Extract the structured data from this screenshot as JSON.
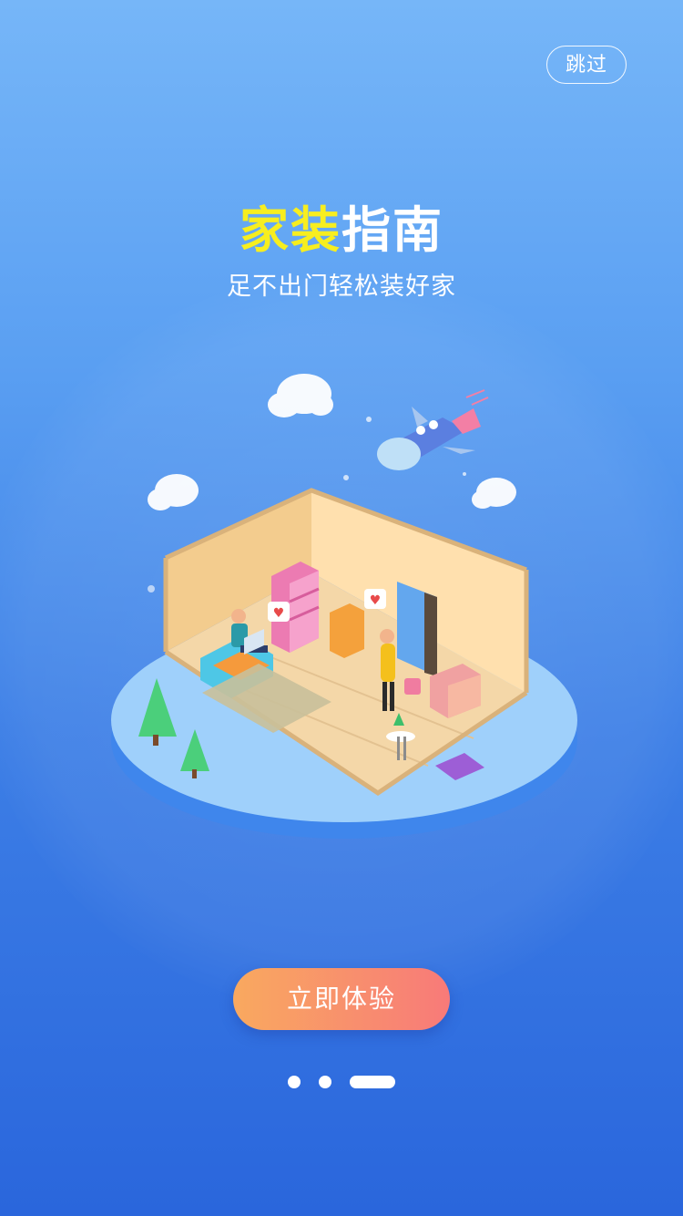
{
  "header": {
    "skip_label": "跳过"
  },
  "hero": {
    "title_highlight": "家装",
    "title_rest": "指南",
    "subtitle": "足不出门轻松装好家"
  },
  "cta": {
    "label": "立即体验"
  },
  "pager": {
    "total": 3,
    "active_index": 2
  },
  "colors": {
    "background_top": "#76b6f8",
    "background_bottom": "#2a66dc",
    "title_highlight": "#f7ee1f",
    "cta_start": "#f9a95f",
    "cta_end": "#f87a79"
  },
  "icons": {
    "illustration": "isometric-room-illustration",
    "clouds": "cloud-icon",
    "rocket": "rocket-icon"
  }
}
